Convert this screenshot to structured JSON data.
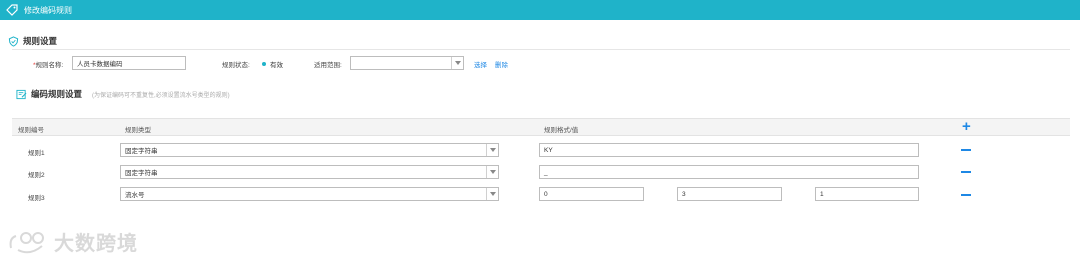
{
  "window": {
    "title": "修改编码规则",
    "accent": "#1fb3c9"
  },
  "rule_settings": {
    "section_title": "规则设置",
    "rule_name_label": "规则名称:",
    "rule_name_value": "人员卡数据编码",
    "rule_status_label": "规则状态:",
    "rule_status_value": "有效",
    "apply_scope_label": "适用范围:",
    "apply_scope_value": "",
    "select_link": "选择",
    "delete_link": "删除"
  },
  "code_rule_settings": {
    "section_title": "编码规则设置",
    "hint": "(为保证编码可不重复性,必须设置流水号类型的规则)"
  },
  "table": {
    "headers": [
      "规则编号",
      "规则类型",
      "规则格式/值"
    ],
    "rows": [
      {
        "name": "规则1",
        "type": "固定字符串",
        "values": [
          "KY"
        ]
      },
      {
        "name": "规则2",
        "type": "固定字符串",
        "values": [
          "_"
        ]
      },
      {
        "name": "规则3",
        "type": "流水号",
        "values": [
          "0",
          "3",
          "1"
        ]
      }
    ]
  },
  "watermark": {
    "text": "大数跨境"
  }
}
